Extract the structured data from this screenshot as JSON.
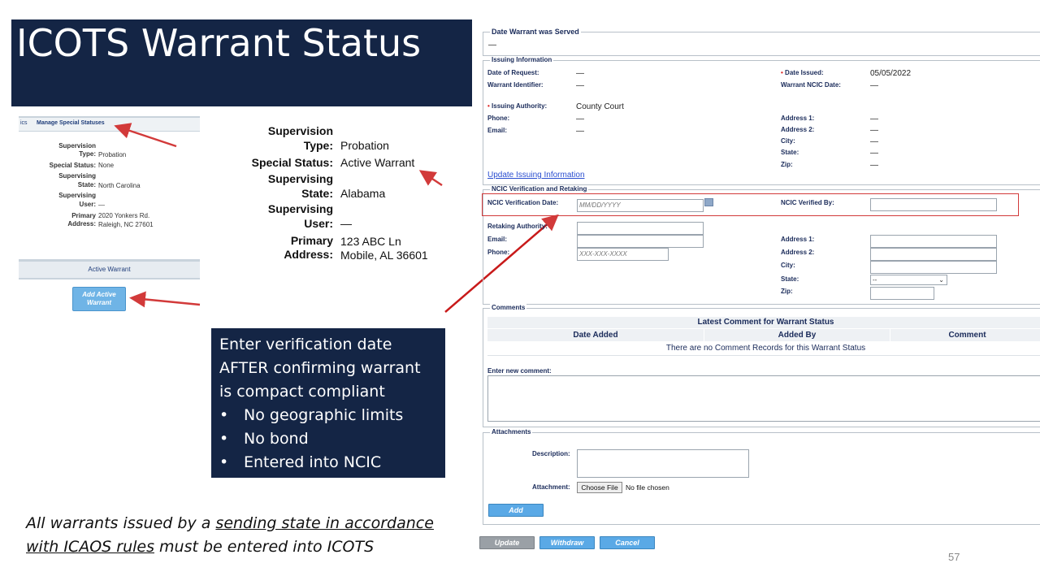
{
  "slide": {
    "title": "ICOTS Warrant Status",
    "page_number": "57",
    "footnote_pre": "All warrants issued by a ",
    "footnote_link": "sending state in accordance with ICAOS rules",
    "footnote_post": " must be entered into ICOTS",
    "footnote_line1_pre": "All warrants issued by a ",
    "footnote_line1_link": "sending state in accordance",
    "footnote_line2_link": "with ICAOS rules",
    "footnote_line2_post": " must be entered into ICOTS"
  },
  "small_screen": {
    "tab_prefix": "ics",
    "tab_label": "Manage Special Statuses",
    "rows": [
      {
        "k": "Supervision Type:",
        "v": "Probation"
      },
      {
        "k": "Special Status:",
        "v": "None"
      },
      {
        "k": "Supervising State:",
        "v": "North Carolina"
      },
      {
        "k": "Supervising User:",
        "v": "—"
      },
      {
        "k": "Primary Address:",
        "v": "2020 Yonkers Rd. Raleigh, NC 27601"
      }
    ],
    "labels": {
      "supervision_1": "Supervision",
      "type": "Type:",
      "type_v": "Probation",
      "special_status": "Special Status:",
      "special_status_v": "None",
      "supervising_1": "Supervising",
      "state": "State:",
      "state_v": "North Carolina",
      "supervising_2": "Supervising",
      "user": "User:",
      "user_v": "—",
      "primary": "Primary",
      "address": "Address:",
      "address_v1": "2020 Yonkers Rd.",
      "address_v2": "Raleigh, NC 27601"
    },
    "active_warrant_header": "Active Warrant",
    "add_button_line1": "Add Active",
    "add_button_line2": "Warrant"
  },
  "middle_info": {
    "supervision_1": "Supervision",
    "type_label": "Type:",
    "type_value": "Probation",
    "special_status_label": "Special Status:",
    "special_status_value": "Active Warrant",
    "supervising_1": "Supervising",
    "state_label": "State:",
    "state_value": "Alabama",
    "supervising_2": "Supervising",
    "user_label": "User:",
    "user_value": "—",
    "primary_label": "Primary",
    "address_label": "Address:",
    "address_line1": "123 ABC Ln",
    "address_line2": "Mobile, AL 36601"
  },
  "callout": {
    "line1": "Enter verification date",
    "line2": "AFTER confirming warrant",
    "line3": "is compact compliant",
    "bullets": [
      "No geographic limits",
      "No bond",
      "Entered into NCIC"
    ]
  },
  "form": {
    "date_served": {
      "legend": "Date Warrant was Served",
      "value": "—"
    },
    "issuing": {
      "legend": "Issuing Information",
      "date_of_request_label": "Date of Request:",
      "date_of_request_value": "—",
      "warrant_identifier_label": "Warrant Identifier:",
      "warrant_identifier_value": "—",
      "issuing_authority_label": "Issuing Authority:",
      "issuing_authority_value": "County Court",
      "phone_label": "Phone:",
      "phone_value": "—",
      "email_label": "Email:",
      "email_value": "—",
      "date_issued_label": "Date Issued:",
      "date_issued_value": "05/05/2022",
      "warrant_ncic_date_label": "Warrant NCIC Date:",
      "warrant_ncic_date_value": "—",
      "address1_label": "Address 1:",
      "address1_value": "—",
      "address2_label": "Address 2:",
      "address2_value": "—",
      "city_label": "City:",
      "city_value": "—",
      "state_label": "State:",
      "state_value": "—",
      "zip_label": "Zip:",
      "zip_value": "—",
      "update_link": "Update Issuing Information"
    },
    "ncic": {
      "legend": "NCIC Verification and Retaking",
      "verification_date_label": "NCIC Verification Date:",
      "verification_date_placeholder": "MM/DD/YYYY",
      "verified_by_label": "NCIC Verified By:",
      "retaking_authority_label": "Retaking Authority:",
      "email_label": "Email:",
      "phone_label": "Phone:",
      "phone_placeholder": "XXX-XXX-XXXX",
      "address1_label": "Address 1:",
      "address2_label": "Address 2:",
      "city_label": "City:",
      "state_label": "State:",
      "state_selected": "--",
      "zip_label": "Zip:"
    },
    "comments": {
      "legend": "Comments",
      "table_title": "Latest Comment for Warrant Status",
      "columns": [
        "Date Added",
        "Added By",
        "Comment"
      ],
      "empty_text": "There are no Comment Records for this Warrant Status",
      "new_comment_label": "Enter new comment:"
    },
    "attachments": {
      "legend": "Attachments",
      "description_label": "Description:",
      "attachment_label": "Attachment:",
      "choose_file_label": "Choose File",
      "no_file_text": "No file chosen",
      "add_button": "Add"
    },
    "buttons": {
      "update": "Update",
      "withdraw": "Withdraw",
      "cancel": "Cancel"
    }
  },
  "colors": {
    "navy": "#142545",
    "arrow_red": "#d23a3a",
    "button_blue": "#5aa9e6",
    "label_blue": "#1a2b5a"
  }
}
